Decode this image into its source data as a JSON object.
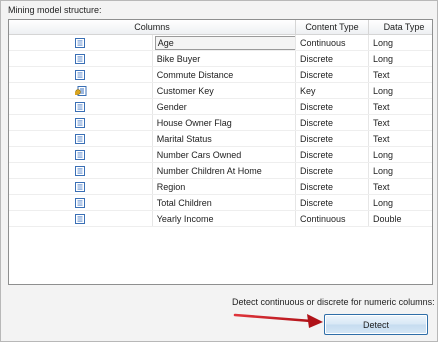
{
  "section_label": "Mining model structure:",
  "grid": {
    "headers": {
      "columns": "Columns",
      "content_type": "Content Type",
      "data_type": "Data Type"
    },
    "rows": [
      {
        "name": "Age",
        "content_type": "Continuous",
        "data_type": "Long",
        "icon": "column-icon",
        "selected": true
      },
      {
        "name": "Bike Buyer",
        "content_type": "Discrete",
        "data_type": "Long",
        "icon": "column-icon"
      },
      {
        "name": "Commute Distance",
        "content_type": "Discrete",
        "data_type": "Text",
        "icon": "column-icon"
      },
      {
        "name": "Customer Key",
        "content_type": "Key",
        "data_type": "Long",
        "icon": "key-column-icon"
      },
      {
        "name": "Gender",
        "content_type": "Discrete",
        "data_type": "Text",
        "icon": "column-icon"
      },
      {
        "name": "House Owner Flag",
        "content_type": "Discrete",
        "data_type": "Text",
        "icon": "column-icon"
      },
      {
        "name": "Marital Status",
        "content_type": "Discrete",
        "data_type": "Text",
        "icon": "column-icon"
      },
      {
        "name": "Number Cars Owned",
        "content_type": "Discrete",
        "data_type": "Long",
        "icon": "column-icon"
      },
      {
        "name": "Number Children At Home",
        "content_type": "Discrete",
        "data_type": "Long",
        "icon": "column-icon"
      },
      {
        "name": "Region",
        "content_type": "Discrete",
        "data_type": "Text",
        "icon": "column-icon"
      },
      {
        "name": "Total Children",
        "content_type": "Discrete",
        "data_type": "Long",
        "icon": "column-icon"
      },
      {
        "name": "Yearly Income",
        "content_type": "Continuous",
        "data_type": "Double",
        "icon": "column-icon"
      }
    ]
  },
  "detect": {
    "description": "Detect continuous or discrete for numeric columns:",
    "button_label": "Detect"
  },
  "colors": {
    "arrow": "#c0141b",
    "icon_blue": "#3a6fb5",
    "key_gold": "#d9a520"
  }
}
